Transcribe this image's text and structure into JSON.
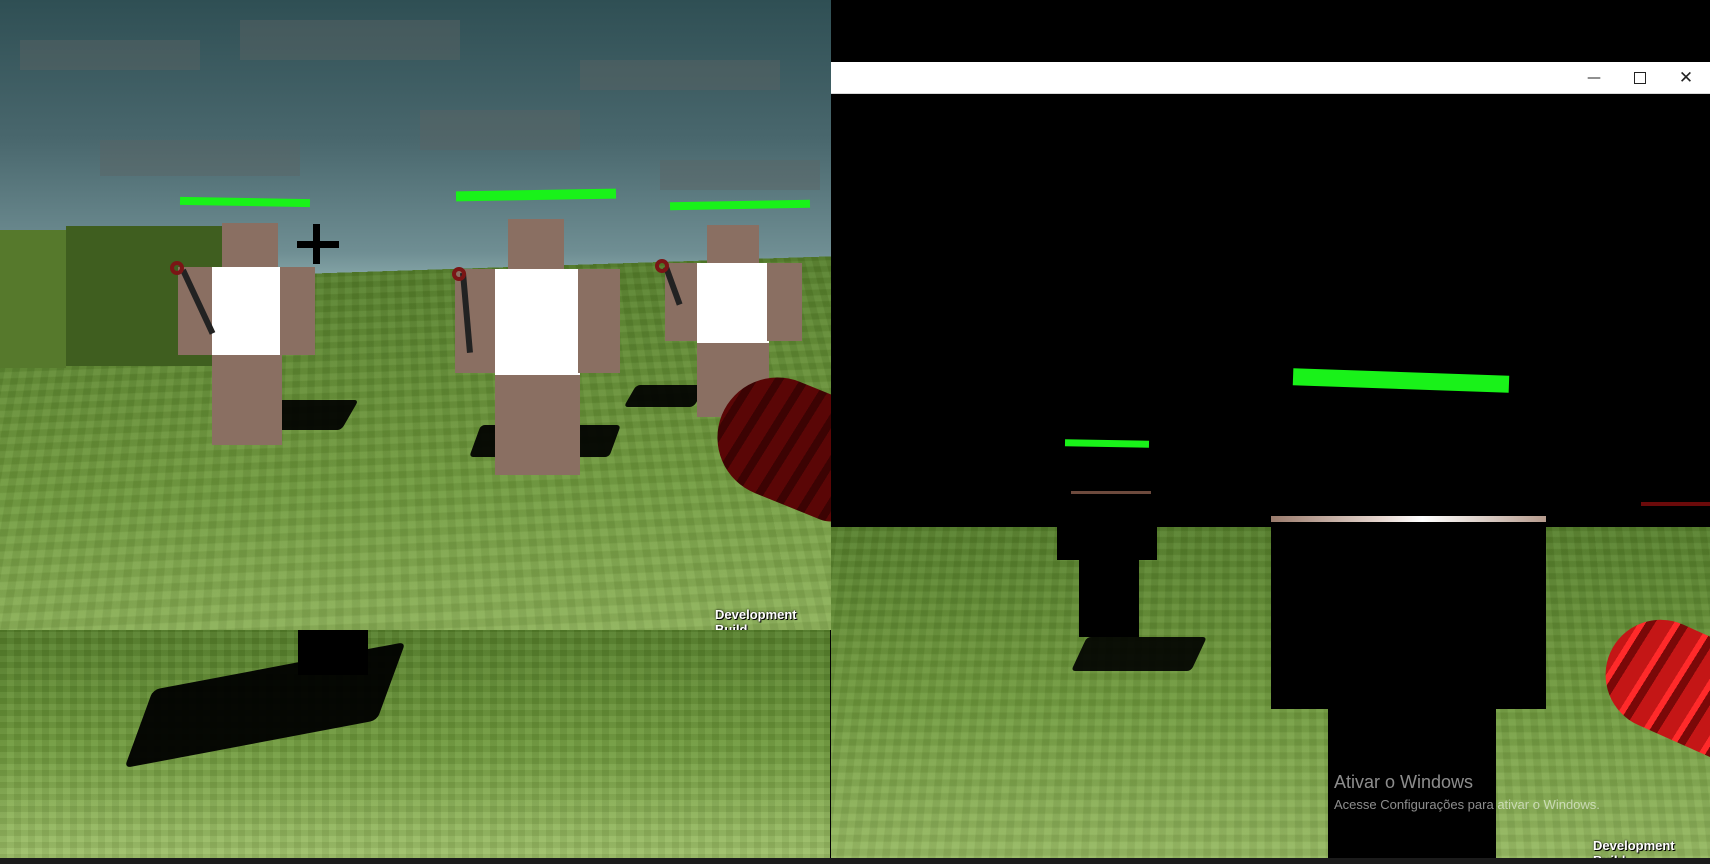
{
  "left_window": {
    "dev_build_label": "Development Build"
  },
  "right_window": {
    "title": "",
    "controls": {
      "minimize_icon": "minimize-icon",
      "maximize_icon": "maximize-icon",
      "close_icon": "close-icon"
    },
    "dev_build_label": "Development Build"
  },
  "activation_watermark": {
    "title": "Ativar o Windows",
    "subtitle": "Acesse Configurações para ativar o Windows."
  },
  "colors": {
    "health_bar": "#19f219",
    "grass": "#6f9a3c",
    "npc_skin": "#8a6f62",
    "weapon_red": "#c41616"
  }
}
